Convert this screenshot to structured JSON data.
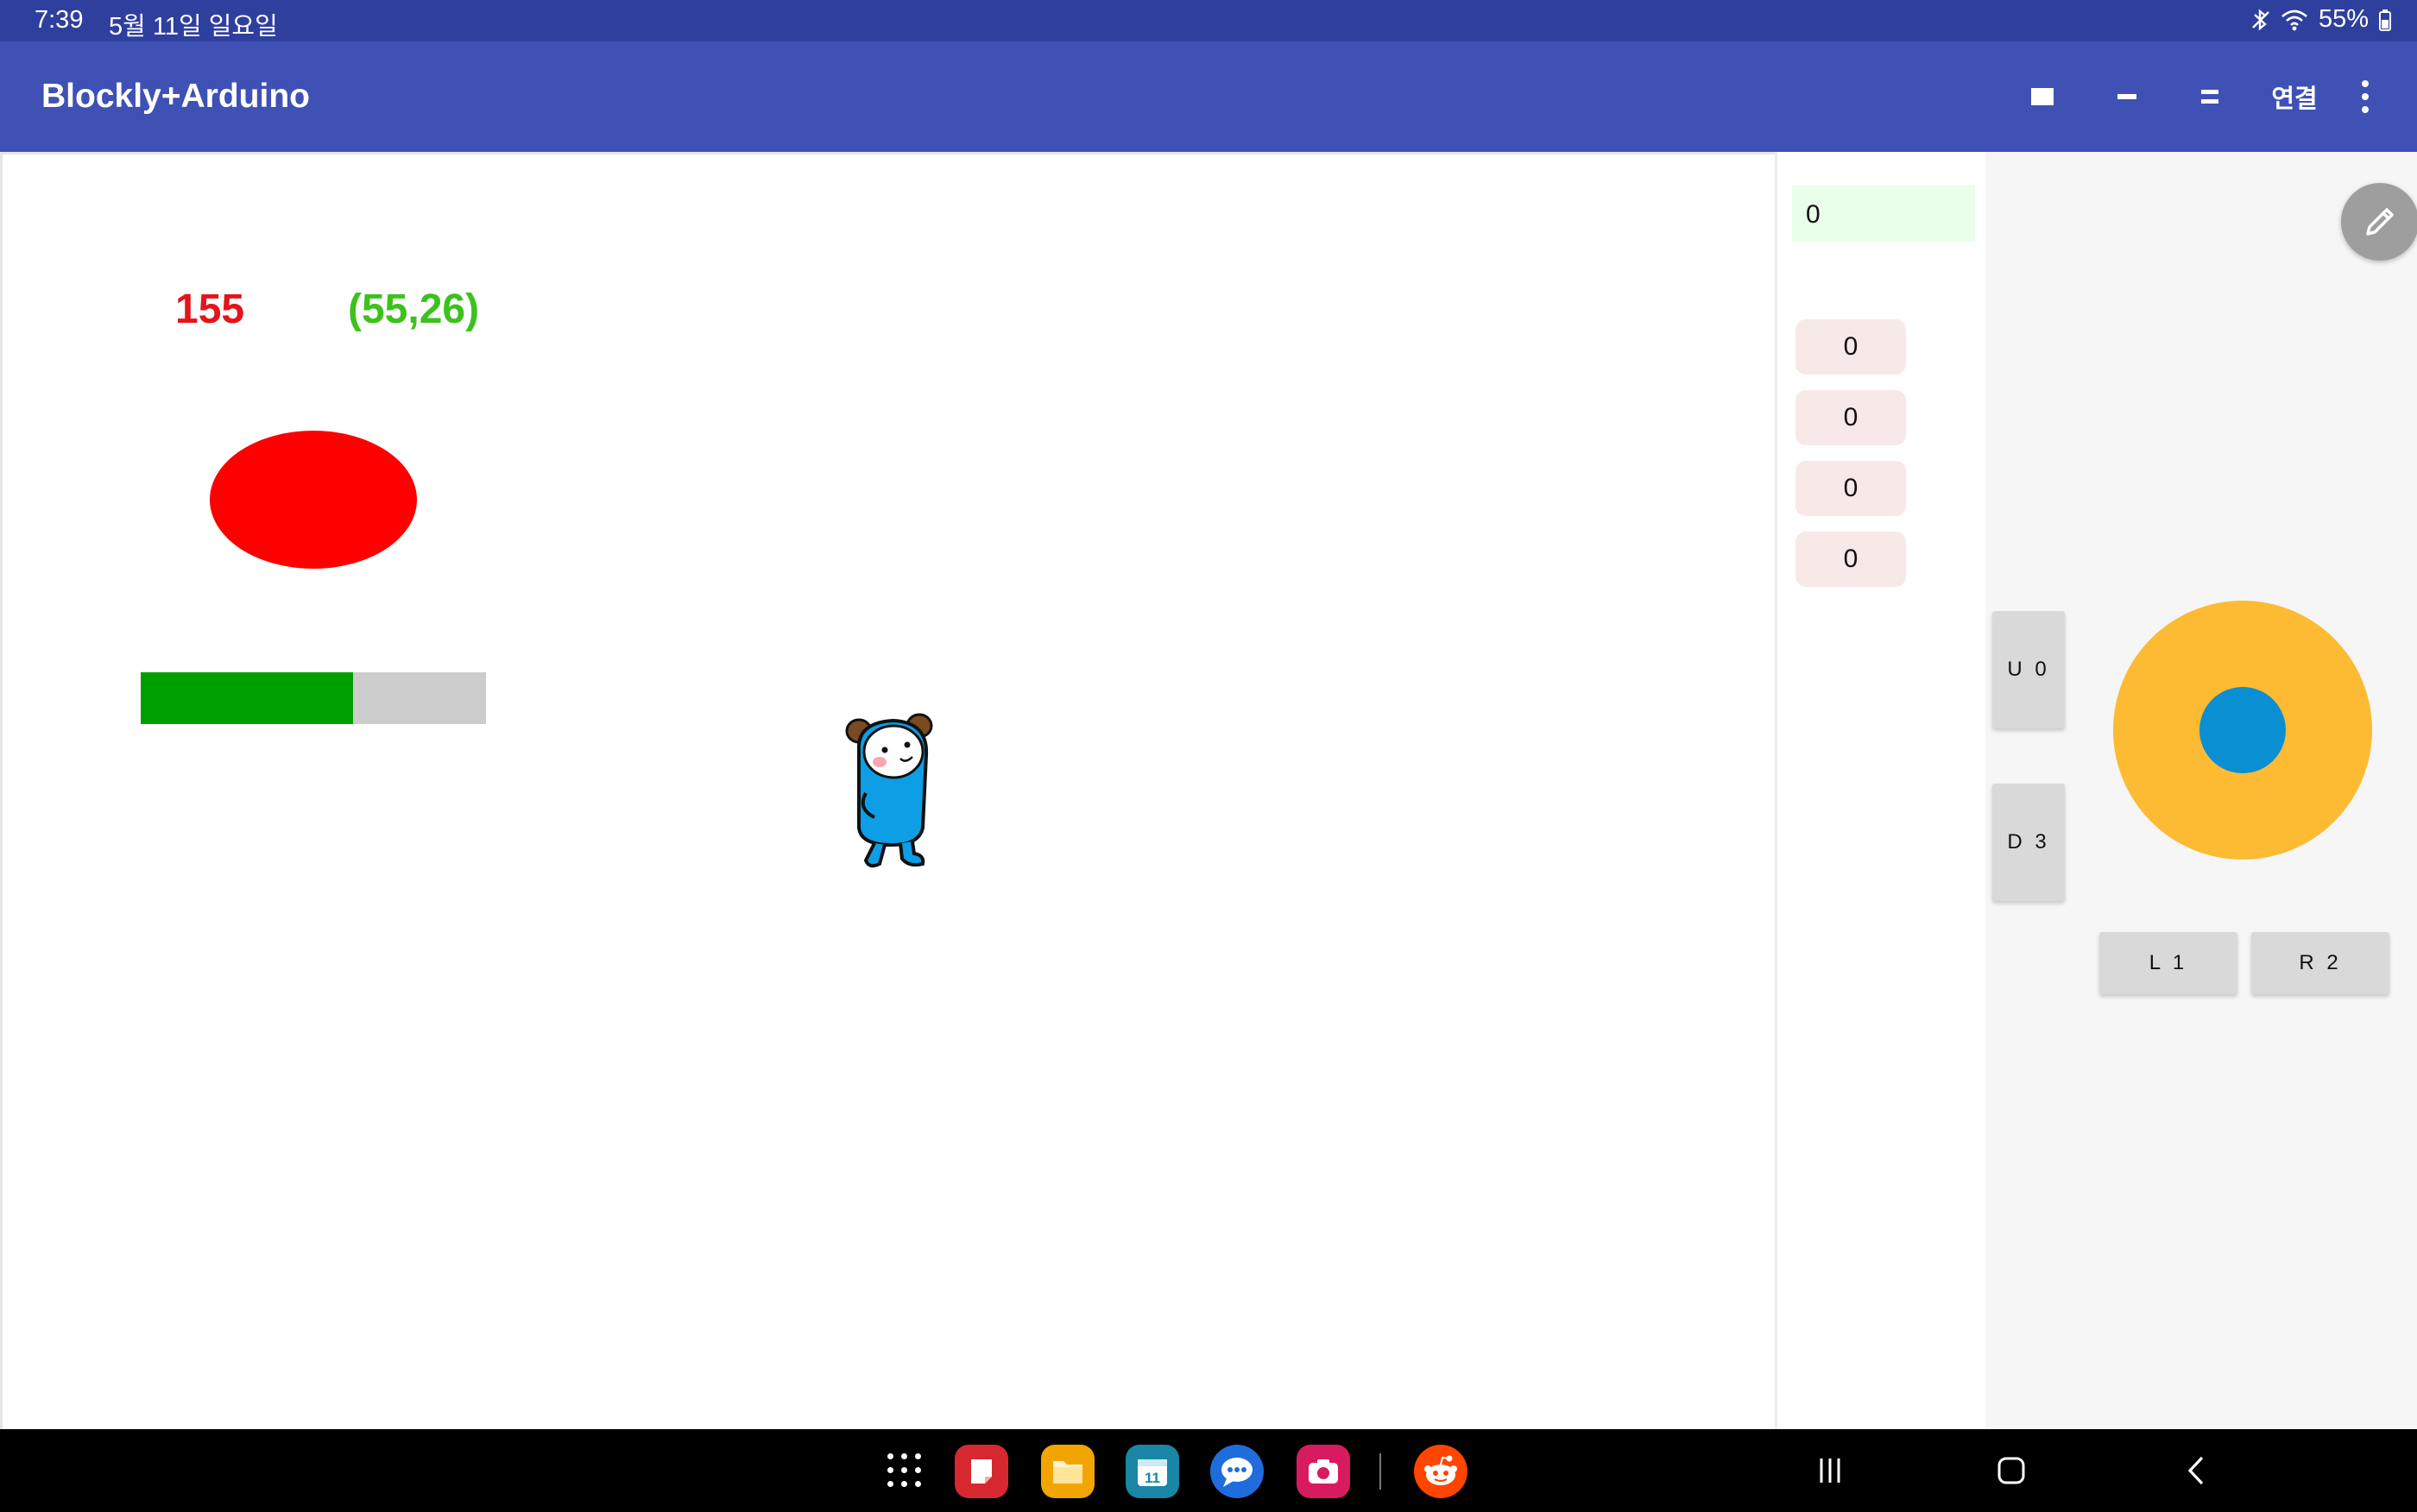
{
  "status_bar": {
    "time": "7:39",
    "date": "5월 11일 일요일",
    "battery": "55%",
    "icons": [
      "bluetooth-off-icon",
      "wifi-icon",
      "battery-icon"
    ]
  },
  "app_bar": {
    "title": "Blockly+Arduino",
    "actions": [
      "stop-icon",
      "single-line-icon",
      "double-line-icon"
    ],
    "connect_label": "연결",
    "overflow_icon": "more-vert-icon",
    "color": "#3f51b5"
  },
  "stage": {
    "value_red": "155",
    "value_green": "(55,26)",
    "ellipse_color": "#ff0000",
    "progress_fraction": 0.615,
    "progress_color": "#009f00",
    "sprite": "blue-bear-sprite"
  },
  "side_panel": {
    "text_field_value": "0",
    "values": [
      "0",
      "0",
      "0",
      "0"
    ],
    "edit_icon": "pencil-icon"
  },
  "gamepad": {
    "up_button": "U 0",
    "down_button": "D 3",
    "left_button": "L 1",
    "right_button": "R 2",
    "joystick_color": "#fdba33",
    "knob_color": "#0a8fd2"
  },
  "nav_bar": {
    "dock_apps": [
      "notes-app-icon",
      "my-files-app-icon",
      "calendar-app-icon",
      "messages-app-icon",
      "camera-app-icon",
      "reddit-app-icon"
    ],
    "calendar_day": "11",
    "keys": [
      "recents-icon",
      "home-icon",
      "back-icon"
    ]
  }
}
